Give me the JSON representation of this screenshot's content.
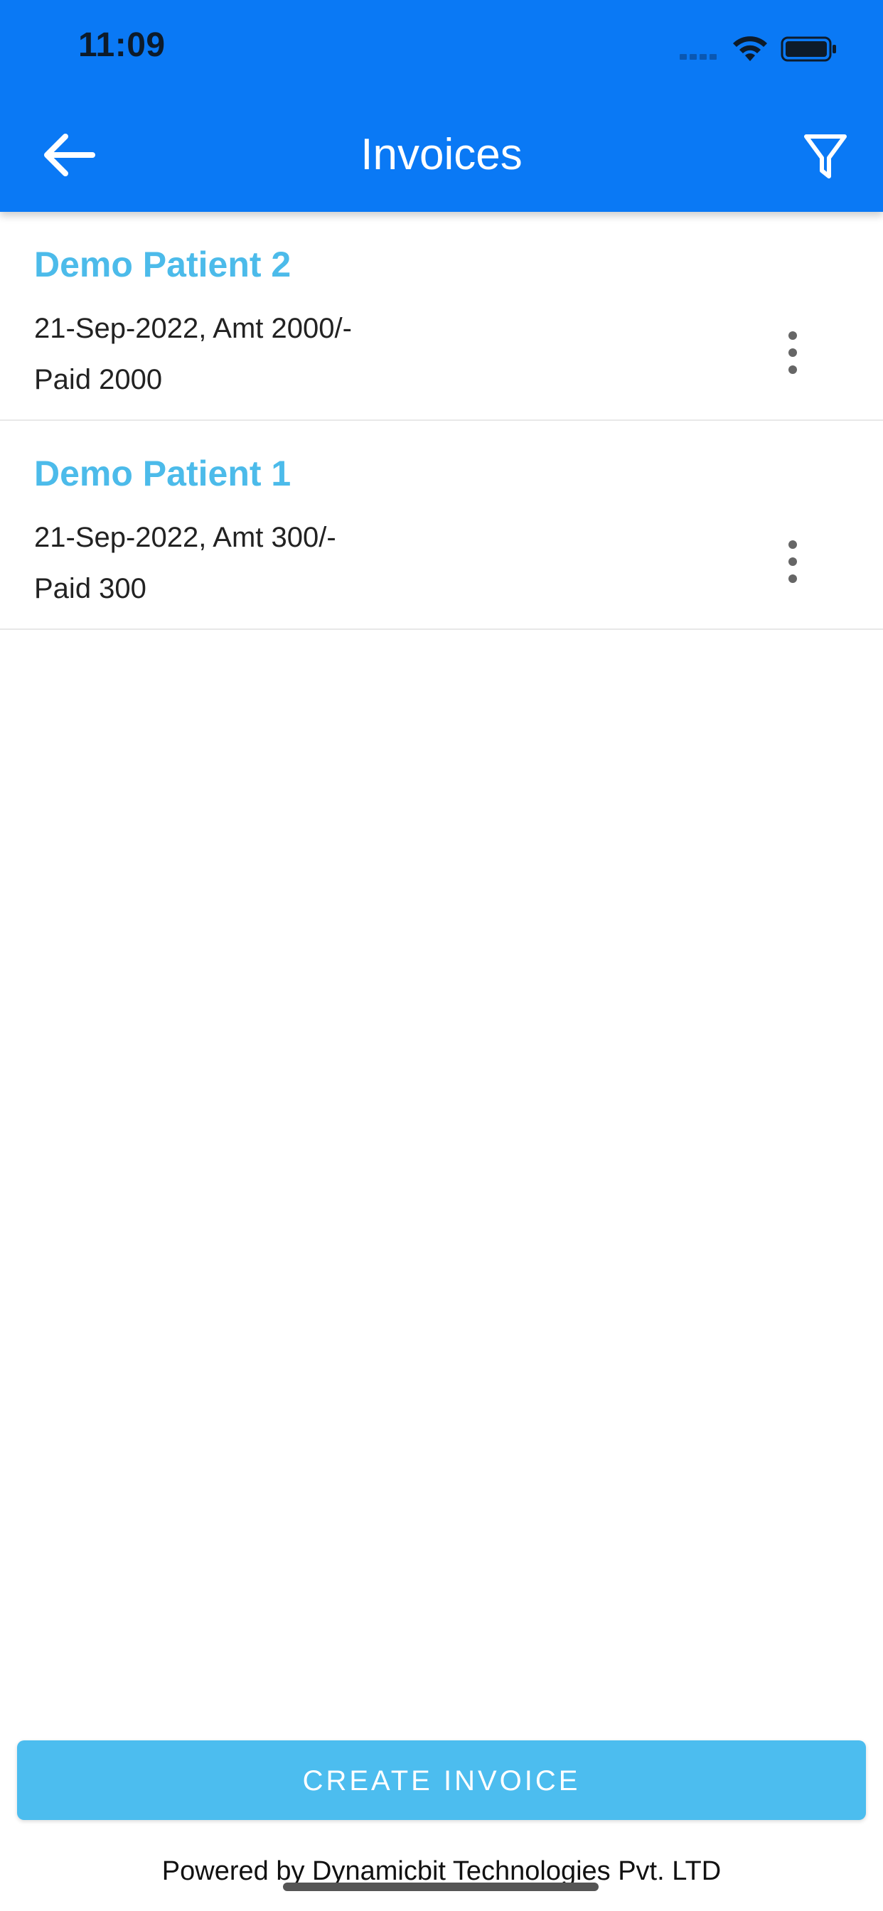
{
  "status_bar": {
    "time": "11:09"
  },
  "header": {
    "title": "Invoices",
    "back_icon": "arrow-left-icon",
    "filter_icon": "filter-icon",
    "background_color": "#0a79f5"
  },
  "invoices": [
    {
      "patient_name": "Demo Patient 2",
      "line1": "21-Sep-2022, Amt 2000/-",
      "line2": "Paid 2000"
    },
    {
      "patient_name": "Demo Patient 1",
      "line1": "21-Sep-2022, Amt 300/-",
      "line2": "Paid 300"
    }
  ],
  "actions": {
    "create_label": "CREATE INVOICE",
    "accent_color": "#4cbdef"
  },
  "footer": {
    "text": "Powered by Dynamicbit Technologies Pvt. LTD"
  }
}
